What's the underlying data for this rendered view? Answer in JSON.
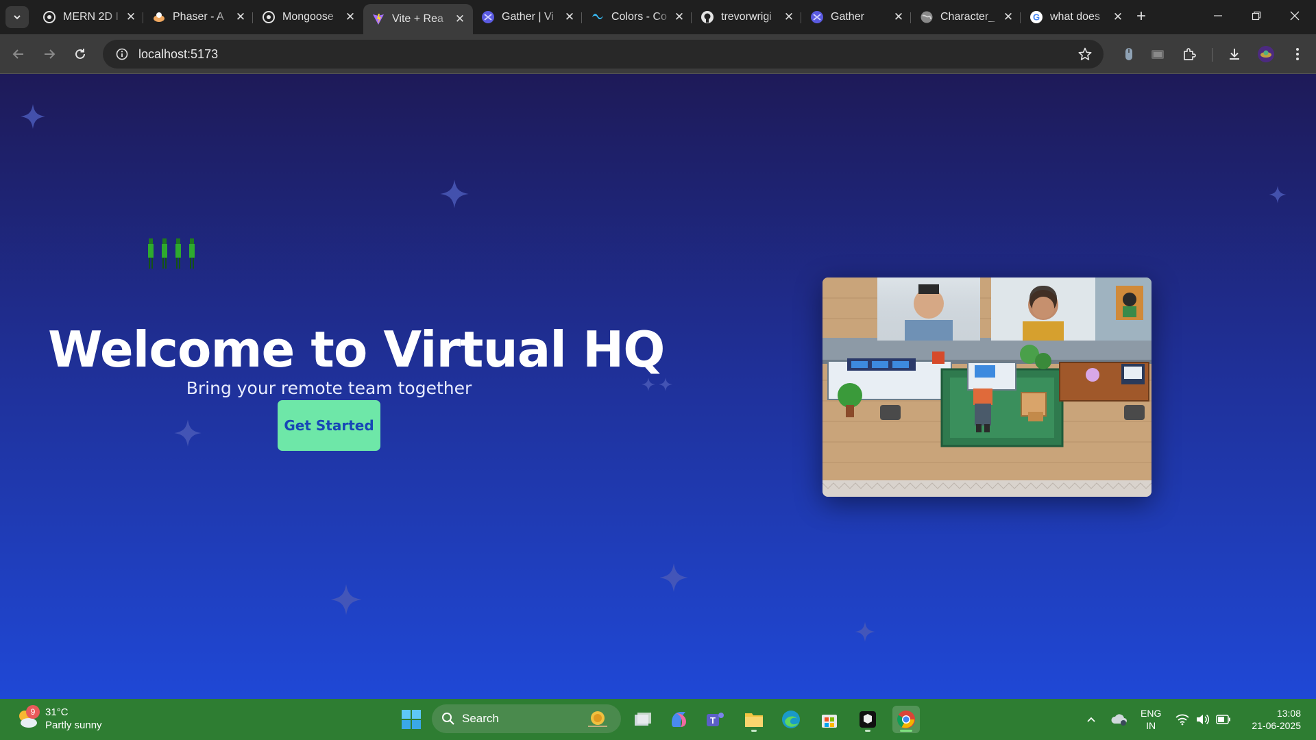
{
  "browser": {
    "tabs": [
      {
        "title": "MERN 2D I",
        "favicon": "openai-icon",
        "color": "#e3e3e3",
        "active": false
      },
      {
        "title": "Phaser - A",
        "favicon": "phaser-icon",
        "color": "#f0a860",
        "active": false
      },
      {
        "title": "Mongoose",
        "favicon": "openai-icon",
        "color": "#e3e3e3",
        "active": false
      },
      {
        "title": "Vite + Rea",
        "favicon": "vite-icon",
        "color": "#a770ff",
        "active": true
      },
      {
        "title": "Gather | Vi",
        "favicon": "gather-icon",
        "color": "#6c6cf0",
        "active": false
      },
      {
        "title": "Colors - Co",
        "favicon": "tailwind-icon",
        "color": "#38bdf8",
        "active": false
      },
      {
        "title": "trevorwrigi",
        "favicon": "github-icon",
        "color": "#e3e3e3",
        "active": false
      },
      {
        "title": "Gather",
        "favicon": "gather-icon",
        "color": "#6c6cf0",
        "active": false
      },
      {
        "title": "Character_",
        "favicon": "globe-icon",
        "color": "#9e9e9e",
        "active": false
      },
      {
        "title": "what does",
        "favicon": "google-icon",
        "color": "#ffffff",
        "active": false
      }
    ],
    "close_glyph": "✕",
    "new_tab_glyph": "+",
    "url": "localhost:5173"
  },
  "page": {
    "title": "Welcome to Virtual HQ",
    "subtitle": "Bring your remote team together",
    "cta_label": "Get Started"
  },
  "taskbar": {
    "weather_badge": "9",
    "temperature": "31°C",
    "condition": "Partly sunny",
    "search_label": "Search",
    "lang_line1": "ENG",
    "lang_line2": "IN",
    "time": "13:08",
    "date": "21-06-2025"
  },
  "colors": {
    "accent": "#6ee7a8",
    "cta_text": "#1747b6",
    "taskbar": "#2e7d32"
  }
}
